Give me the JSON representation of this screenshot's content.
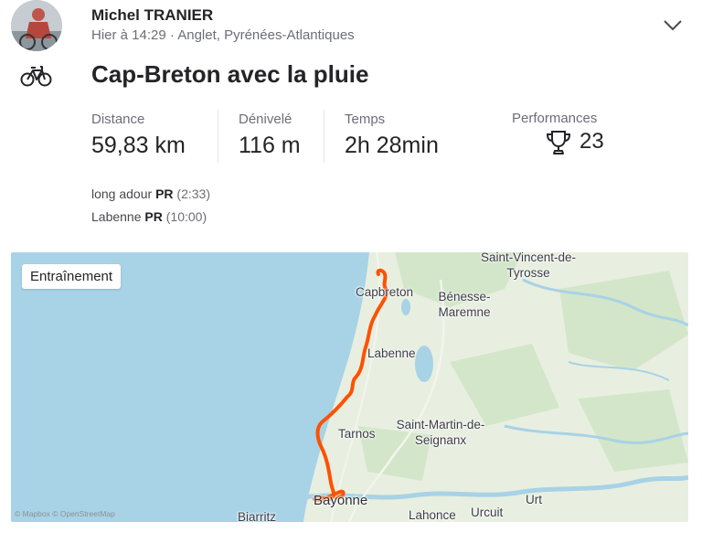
{
  "athlete": {
    "name": "Michel TRANIER",
    "meta": "Hier à 14:29 · Anglet, Pyrénées-Atlantiques"
  },
  "activity": {
    "title": "Cap-Breton avec la pluie",
    "sport_icon": "bicycle-icon",
    "stats": [
      {
        "label": "Distance",
        "value": "59,83 km"
      },
      {
        "label": "Dénivelé",
        "value": "116 m"
      },
      {
        "label": "Temps",
        "value": "2h 28min"
      }
    ],
    "performances": {
      "label": "Performances",
      "count": "23",
      "icon": "trophy-icon"
    },
    "prs": [
      {
        "segment": "long adour",
        "badge": "PR",
        "time": "(2:33)"
      },
      {
        "segment": "Labenne",
        "badge": "PR",
        "time": "(10:00)"
      }
    ]
  },
  "map": {
    "badge": "Entraînement",
    "attribution": "© Mapbox © OpenStreetMap",
    "places": {
      "saint_vincent": "Saint-Vincent-de-Tyrosse",
      "capbreton": "Capbreton",
      "benesse": "Bénesse-Maremne",
      "labenne": "Labenne",
      "tarnos": "Tarnos",
      "saint_martin": "Saint-Martin-de-Seignanx",
      "bayonne": "Bayonne",
      "biarritz": "Biarritz",
      "lahonce": "Lahonce",
      "urcuit": "Urcuit",
      "urt": "Urt"
    },
    "colors": {
      "sea": "#a8d2e6",
      "land": "#e8efe0",
      "forest": "#d3e6c9",
      "route": "#fc5200",
      "water": "#a8d2e6"
    }
  }
}
